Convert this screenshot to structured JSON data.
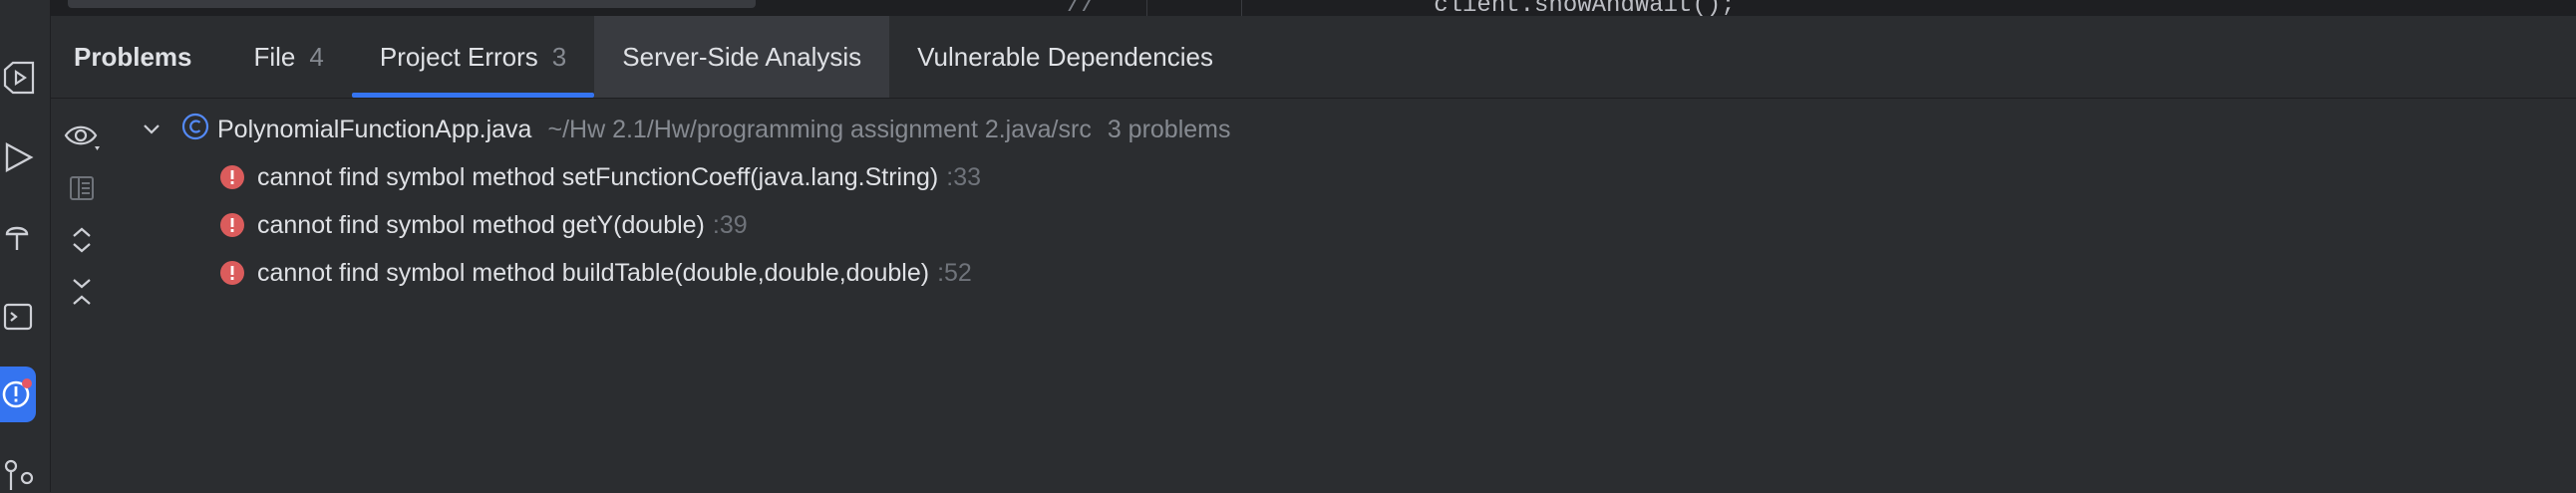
{
  "colors": {
    "background": "#2b2d30",
    "accent": "#3574f0",
    "error": "#db5c5c",
    "muted_text": "#868a91"
  },
  "editor": {
    "comment_fragment": "//",
    "code_fragment": "   client.showAndWait();"
  },
  "tabs": [
    {
      "label": "Problems",
      "count": ""
    },
    {
      "label": "File",
      "count": "4"
    },
    {
      "label": "Project Errors",
      "count": "3"
    },
    {
      "label": "Server-Side Analysis",
      "count": ""
    },
    {
      "label": "Vulnerable Dependencies",
      "count": ""
    }
  ],
  "tree": {
    "file": {
      "name": "PolynomialFunctionApp.java",
      "path": "~/Hw 2.1/Hw/programming assignment 2.java/src",
      "problems": "3 problems",
      "icon": "class-c-icon"
    },
    "errors": [
      {
        "message": "cannot find symbol method setFunctionCoeff(java.lang.String)",
        "line": ":33"
      },
      {
        "message": "cannot find symbol method getY(double)",
        "line": ":39"
      },
      {
        "message": "cannot find symbol method buildTable(double,double,double)",
        "line": ":52"
      }
    ]
  },
  "toolbar_icons": [
    "eye-icon",
    "preview-icon",
    "expand-all-icon",
    "collapse-all-icon"
  ],
  "left_strip_icons": [
    "run-services-icon",
    "run-icon",
    "test-icon",
    "terminal-icon",
    "problems-icon",
    "git-icon"
  ]
}
